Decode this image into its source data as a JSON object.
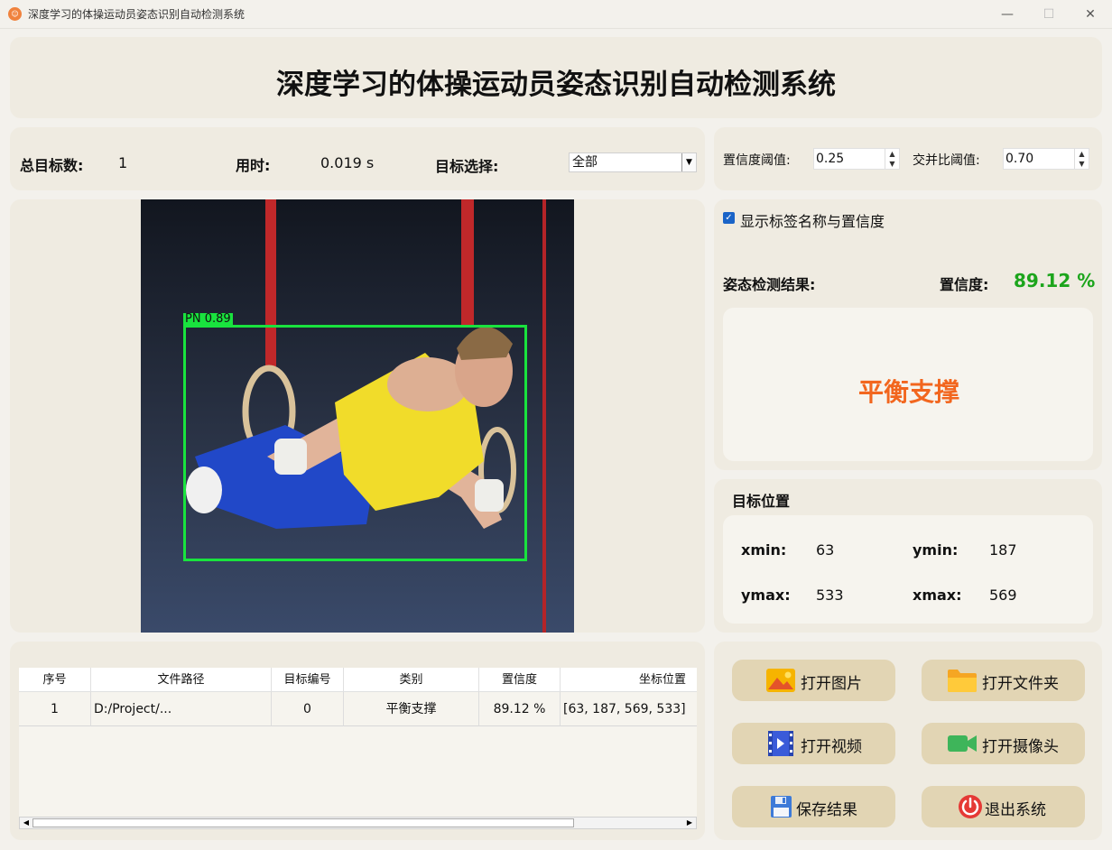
{
  "window": {
    "title": "深度学习的体操运动员姿态识别自动检测系统",
    "app_icon_glyph": "☺",
    "minimize": "—",
    "maximize": "☐",
    "close": "✕"
  },
  "header": {
    "title": "深度学习的体操运动员姿态识别自动检测系统"
  },
  "stats": {
    "total_label": "总目标数:",
    "total_value": "1",
    "time_label": "用时:",
    "time_value": "0.019 s",
    "target_label": "目标选择:",
    "target_value": "全部"
  },
  "thresholds": {
    "conf_label": "置信度阈值:",
    "conf_value": "0.25",
    "iou_label": "交并比阈值:",
    "iou_value": "0.70"
  },
  "detection": {
    "box_label": "PN 0.89"
  },
  "options": {
    "show_label": "显示标签名称与置信度",
    "checked": true
  },
  "result": {
    "label": "姿态检测结果:",
    "conf_label": "置信度:",
    "conf_value": "89.12 %",
    "class_name": "平衡支撑",
    "class_color": "#f2661e",
    "conf_color": "#1ca51c"
  },
  "position": {
    "title": "目标位置",
    "xmin_label": "xmin:",
    "xmin": "63",
    "ymin_label": "ymin:",
    "ymin": "187",
    "ymax_label": "ymax:",
    "ymax": "533",
    "xmax_label": "xmax:",
    "xmax": "569"
  },
  "table": {
    "headers": [
      "序号",
      "文件路径",
      "目标编号",
      "类别",
      "置信度",
      "坐标位置"
    ],
    "rows": [
      [
        "1",
        "D:/Project/...",
        "0",
        "平衡支撑",
        "89.12 %",
        "[63, 187, 569, 533]"
      ]
    ]
  },
  "buttons": {
    "open_image": "打开图片",
    "open_folder": "打开文件夹",
    "open_video": "打开视频",
    "open_camera": "打开摄像头",
    "save_result": "保存结果",
    "exit": "退出系统"
  }
}
